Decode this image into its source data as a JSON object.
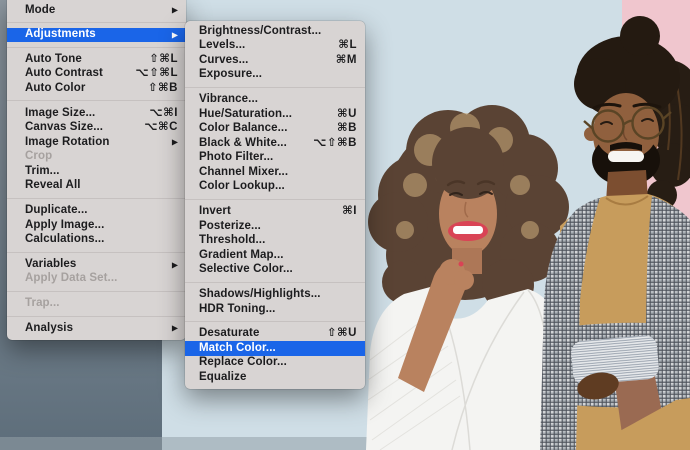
{
  "app": "photoshop-image-menu",
  "glyphs": {
    "submenu_arrow": "▶"
  },
  "colors": {
    "highlight": "#1a65e8",
    "menu_bg": "#d8d4d3",
    "menu_text": "#1c1c1e",
    "menu_disabled": "#a6a19f",
    "separator": "#c6c1c0",
    "wall_blue": "#cfdee6",
    "wall_pink": "#f0c6ce",
    "wall_gray": "#76838e"
  },
  "menus": {
    "image_menu": {
      "items": [
        {
          "label": "Mode",
          "submenu": true
        },
        {
          "sep": true
        },
        {
          "label": "Adjustments",
          "submenu": true,
          "highlighted": true
        },
        {
          "sep": true
        },
        {
          "label": "Auto Tone",
          "shortcut": "⇧⌘L"
        },
        {
          "label": "Auto Contrast",
          "shortcut": "⌥⇧⌘L"
        },
        {
          "label": "Auto Color",
          "shortcut": "⇧⌘B"
        },
        {
          "sep": true
        },
        {
          "label": "Image Size...",
          "shortcut": "⌥⌘I"
        },
        {
          "label": "Canvas Size...",
          "shortcut": "⌥⌘C"
        },
        {
          "label": "Image Rotation",
          "submenu": true
        },
        {
          "label": "Crop",
          "disabled": true
        },
        {
          "label": "Trim..."
        },
        {
          "label": "Reveal All"
        },
        {
          "sep": true
        },
        {
          "label": "Duplicate..."
        },
        {
          "label": "Apply Image..."
        },
        {
          "label": "Calculations..."
        },
        {
          "sep": true
        },
        {
          "label": "Variables",
          "submenu": true
        },
        {
          "label": "Apply Data Set...",
          "disabled": true
        },
        {
          "sep": true
        },
        {
          "label": "Trap...",
          "disabled": true
        },
        {
          "sep": true
        },
        {
          "label": "Analysis",
          "submenu": true
        }
      ]
    },
    "adjustments_submenu": {
      "items": [
        {
          "label": "Brightness/Contrast..."
        },
        {
          "label": "Levels...",
          "shortcut": "⌘L"
        },
        {
          "label": "Curves...",
          "shortcut": "⌘M"
        },
        {
          "label": "Exposure..."
        },
        {
          "sep": true
        },
        {
          "label": "Vibrance..."
        },
        {
          "label": "Hue/Saturation...",
          "shortcut": "⌘U"
        },
        {
          "label": "Color Balance...",
          "shortcut": "⌘B"
        },
        {
          "label": "Black & White...",
          "shortcut": "⌥⇧⌘B"
        },
        {
          "label": "Photo Filter..."
        },
        {
          "label": "Channel Mixer..."
        },
        {
          "label": "Color Lookup..."
        },
        {
          "sep": true
        },
        {
          "label": "Invert",
          "shortcut": "⌘I"
        },
        {
          "label": "Posterize..."
        },
        {
          "label": "Threshold..."
        },
        {
          "label": "Gradient Map..."
        },
        {
          "label": "Selective Color..."
        },
        {
          "sep": true
        },
        {
          "label": "Shadows/Highlights..."
        },
        {
          "label": "HDR Toning..."
        },
        {
          "sep": true
        },
        {
          "label": "Desaturate",
          "shortcut": "⇧⌘U"
        },
        {
          "label": "Match Color...",
          "highlighted": true
        },
        {
          "label": "Replace Color..."
        },
        {
          "label": "Equalize"
        }
      ]
    }
  }
}
